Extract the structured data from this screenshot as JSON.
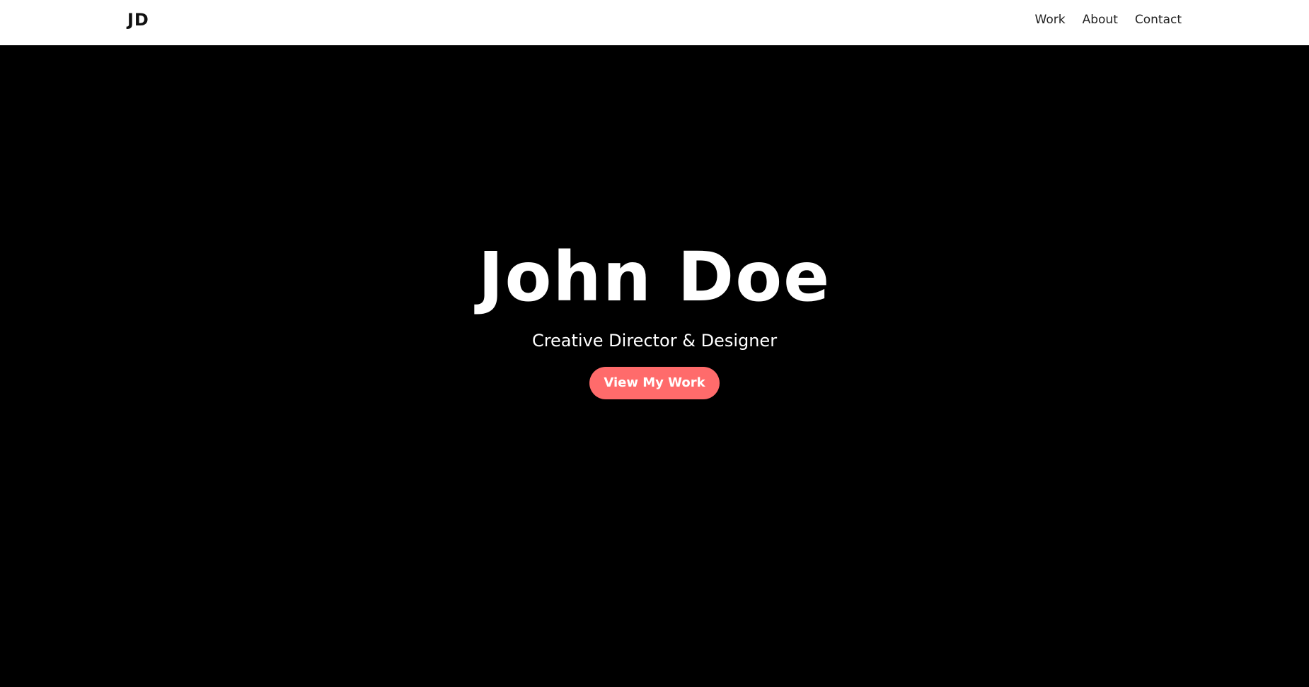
{
  "nav": {
    "logo": "JD",
    "links": [
      {
        "label": "Work"
      },
      {
        "label": "About"
      },
      {
        "label": "Contact"
      }
    ]
  },
  "hero": {
    "title": "John Doe",
    "subtitle": "Creative Director & Designer",
    "cta_label": "View My Work"
  },
  "colors": {
    "accent": "#ff6b6b",
    "hero_bg": "#000000",
    "nav_bg": "#ffffff"
  }
}
